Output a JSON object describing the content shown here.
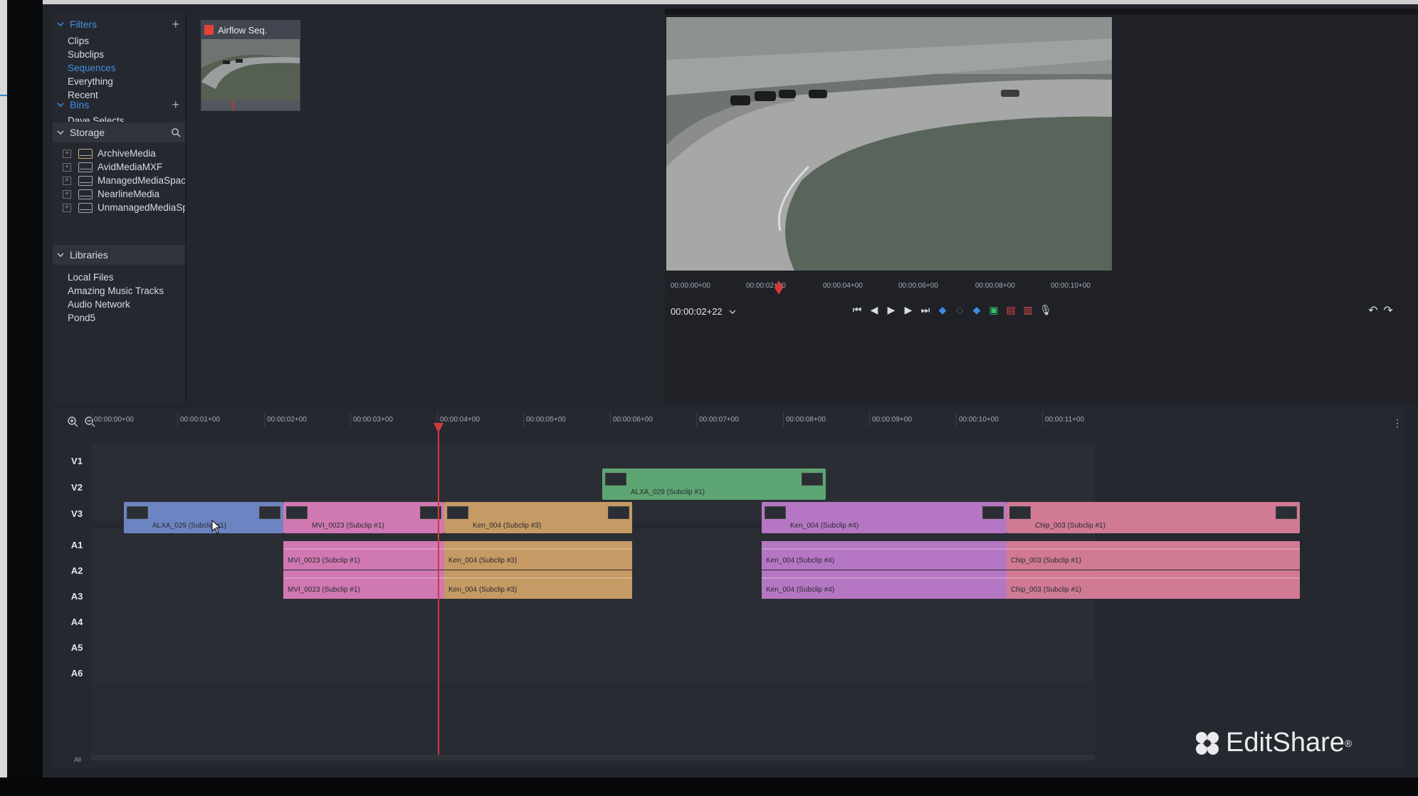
{
  "browser": {
    "filters_label": "Filters",
    "filters": [
      "Clips",
      "Subclips",
      "Sequences",
      "Everything",
      "Recent"
    ],
    "active_filter": "Sequences",
    "bins_label": "Bins",
    "bins_item": "Dave Selects",
    "storage_label": "Storage",
    "storage_items": [
      "ArchiveMedia",
      "AvidMediaMXF",
      "ManagedMediaSpac",
      "NearlineMedia",
      "UnmanagedMediaSp"
    ],
    "libraries_label": "Libraries",
    "libraries": [
      "Local Files",
      "Amazing Music Tracks",
      "Audio Network",
      "Pond5"
    ]
  },
  "bin": {
    "sequence_title": "Airflow Seq."
  },
  "viewer": {
    "ruler_ticks": [
      "00:00:00+00",
      "00:00:02+00",
      "00:00:04+00",
      "00:00:06+00",
      "00:00:08+00",
      "00:00:10+00"
    ],
    "timecode": "00:00:02+22",
    "controls": [
      "go-to-start",
      "step-back",
      "play",
      "step-forward",
      "go-to-end",
      "mark-in",
      "clear-marks",
      "mark-out",
      "add-marker",
      "lift",
      "extract",
      "voiceover"
    ],
    "undo_redo": [
      "undo",
      "redo"
    ]
  },
  "timeline": {
    "ruler_ticks": [
      "00:00:00+00",
      "00:00:01+00",
      "00:00:02+00",
      "00:00:03+00",
      "00:00:04+00",
      "00:00:05+00",
      "00:00:06+00",
      "00:00:07+00",
      "00:00:08+00",
      "00:00:09+00",
      "00:00:10+00",
      "00:00:11+00"
    ],
    "tracks": [
      "V1",
      "V2",
      "V3",
      "A1",
      "A2",
      "A3",
      "A4",
      "A5",
      "A6"
    ],
    "all_label": "All",
    "clips": {
      "v2_alxa": "ALXA_029  (Subclip #1)",
      "v3_alxa": "ALXA_029  (Subclip #1)",
      "v3_mvi": "MVI_0023  (Subclip #1)",
      "v3_ken3": "Ken_004  (Subclip #3)",
      "v3_ken4": "Ken_004  (Subclip #4)",
      "v3_chip": "Chip_003  (Subclip #1)",
      "a1_mvi": "MVI_0023  (Subclip #1)",
      "a1_ken3": "Ken_004  (Subclip #3)",
      "a1_ken4": "Ken_004  (Subclip #4)",
      "a1_chip": "Chip_003  (Subclip #1)",
      "a2_mvi": "MVI_0023  (Subclip #1)",
      "a2_ken3": "Ken_004  (Subclip #3)",
      "a2_ken4": "Ken_004  (Subclip #4)",
      "a2_chip": "Chip_003  (Subclip #1)"
    }
  },
  "brand": {
    "name": "EditShare",
    "registered": "®"
  },
  "colors": {
    "accent_blue": "#3f8fe0",
    "playhead_red": "#d23a3a",
    "clip_blue": "#6c84c2",
    "clip_pink": "#cf78b2",
    "clip_tan": "#c59a64",
    "clip_green": "#5da572",
    "clip_purple": "#b577c3",
    "clip_rose": "#d07a94"
  }
}
